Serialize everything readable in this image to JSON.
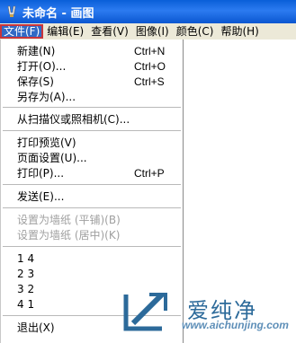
{
  "window": {
    "title": "未命名 - 画图",
    "icon": "paint-brush-icon"
  },
  "menubar": [
    {
      "label": "文件(F)",
      "active": true
    },
    {
      "label": "编辑(E)"
    },
    {
      "label": "查看(V)"
    },
    {
      "label": "图像(I)"
    },
    {
      "label": "颜色(C)"
    },
    {
      "label": "帮助(H)"
    }
  ],
  "file_menu": {
    "new": {
      "label": "新建(N)",
      "shortcut": "Ctrl+N"
    },
    "open": {
      "label": "打开(O)...",
      "shortcut": "Ctrl+O"
    },
    "save": {
      "label": "保存(S)",
      "shortcut": "Ctrl+S"
    },
    "save_as": {
      "label": "另存为(A)..."
    },
    "from_scanner": {
      "label": "从扫描仪或照相机(C)..."
    },
    "print_preview": {
      "label": "打印预览(V)"
    },
    "page_setup": {
      "label": "页面设置(U)..."
    },
    "print": {
      "label": "打印(P)...",
      "shortcut": "Ctrl+P"
    },
    "send": {
      "label": "发送(E)..."
    },
    "wallpaper_tile": {
      "label": "设置为墙纸 (平铺)(B)"
    },
    "wallpaper_center": {
      "label": "设置为墙纸 (居中)(K)"
    },
    "recent": [
      "1 4",
      "2 3",
      "3 2",
      "4 1"
    ],
    "exit": {
      "label": "退出(X)"
    }
  },
  "watermark": {
    "name": "爱纯净",
    "url": "www.aichunjing.com"
  }
}
